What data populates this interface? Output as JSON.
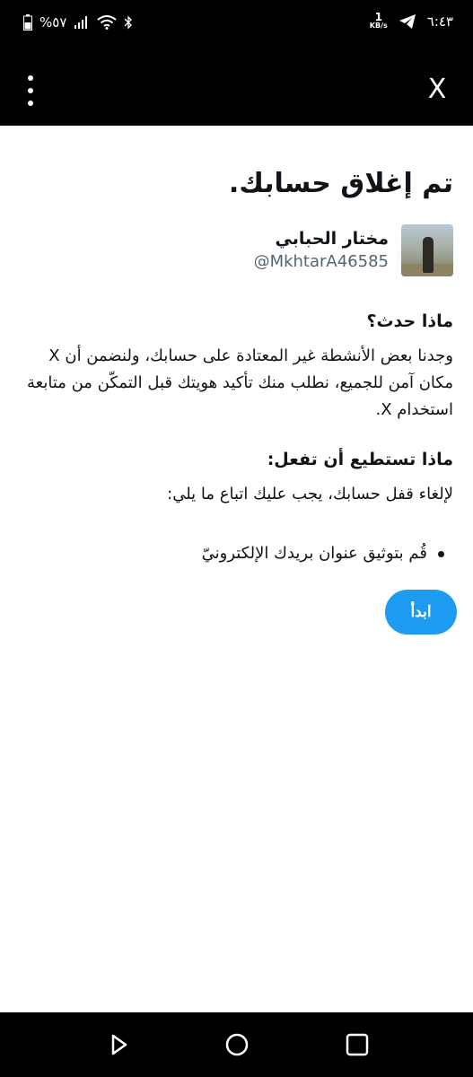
{
  "status_bar": {
    "battery_percent": "%٥٧",
    "time": "٦:٤٣",
    "net_speed": "1",
    "net_speed_unit": "KB/s"
  },
  "app_bar": {
    "menu_icon": "more-vert-icon",
    "close_label": "X"
  },
  "content": {
    "title": "تم إغلاق حسابك.",
    "user": {
      "name": "مختار الحبابي",
      "handle": "@MkhtarA46585"
    },
    "what_happened": {
      "heading": "ماذا حدث؟",
      "body": "وجدنا بعض الأنشطة غير المعتادة على حسابك، ولنضمن أن X مكان آمن للجميع، نطلب منك تأكيد هويتك قبل التمكّن من متابعة استخدام X."
    },
    "what_you_can_do": {
      "heading": "ماذا تستطيع أن تفعل:",
      "body": "لإلغاء قفل حسابك، يجب عليك اتباع ما يلي:",
      "steps": [
        "قُم بتوثيق عنوان بريدك الإلكترونيّ"
      ]
    },
    "start_button": "ابدأ"
  },
  "nav": {
    "back_icon": "back-triangle-icon",
    "home_icon": "home-circle-icon",
    "recents_icon": "recents-square-icon"
  },
  "colors": {
    "accent": "#1d9bf0",
    "text": "#0f1419",
    "secondary_text": "#536471",
    "bar_background": "#000000"
  }
}
